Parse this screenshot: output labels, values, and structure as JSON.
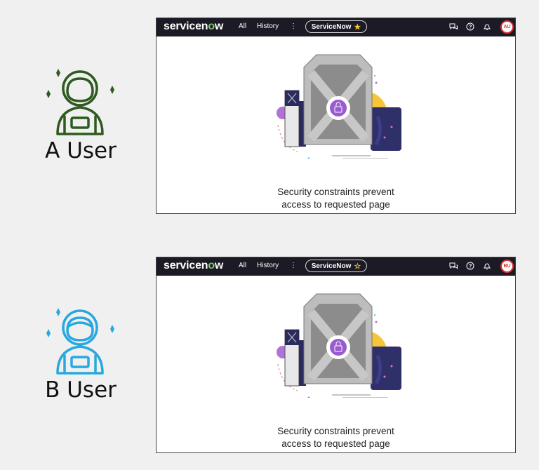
{
  "users": [
    {
      "label": "A User",
      "icon": "astronaut-male-icon",
      "icon_color": "#2e5a1f",
      "navbar": {
        "logo": "servicenow",
        "nav_all": "All",
        "nav_history": "History",
        "nav_more": "⋮",
        "pill_label": "ServiceNow",
        "pill_star": "★",
        "avatar_initials": "AU"
      },
      "message_line1": "Security constraints prevent",
      "message_line2": "access to requested page"
    },
    {
      "label": "B User",
      "icon": "astronaut-female-icon",
      "icon_color": "#29a8e0",
      "navbar": {
        "logo": "servicenow",
        "nav_all": "All",
        "nav_history": "History",
        "nav_more": "⋮",
        "pill_label": "ServiceNow",
        "pill_star": "☆",
        "avatar_initials": "BU"
      },
      "message_line1": "Security constraints prevent",
      "message_line2": "access to requested page"
    }
  ]
}
